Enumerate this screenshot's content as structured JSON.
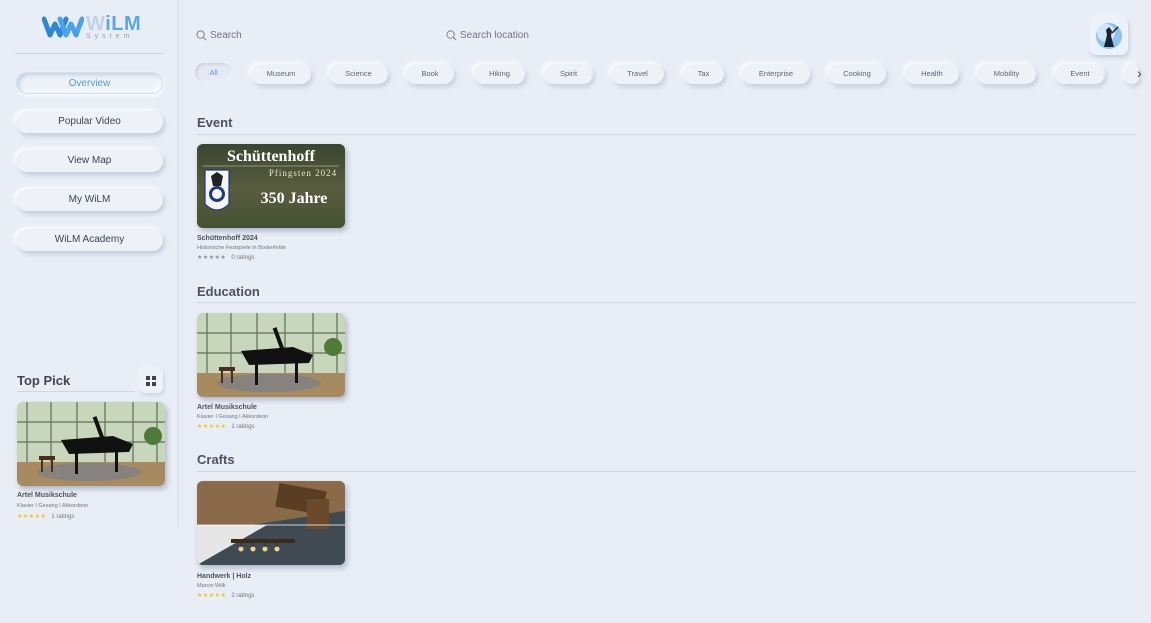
{
  "app": {
    "logo_word_prefix": "W",
    "logo_word_rest": "iLM",
    "logo_sub": "System"
  },
  "sidebar": {
    "nav": [
      {
        "label": "Overview",
        "active": true
      },
      {
        "label": "Popular Video",
        "active": false
      },
      {
        "label": "View Map",
        "active": false
      },
      {
        "label": "My WiLM",
        "active": false
      },
      {
        "label": "WiLM Academy",
        "active": false
      }
    ],
    "top_pick": {
      "title": "Top Pick",
      "card": {
        "title": "Artel Musikschule",
        "subtitle": "Klavier I Gesang I Akkordeon",
        "ratings": "1 ratings",
        "stars": "★★★★★",
        "star_color": "gold"
      }
    }
  },
  "header": {
    "search_placeholder": "Search",
    "location_placeholder": "Search location"
  },
  "categories": {
    "items": [
      "All",
      "Museum",
      "Science",
      "Book",
      "Hiking",
      "Spirit",
      "Travel",
      "Tax",
      "Enterprise",
      "Cooking",
      "Health",
      "Mobility",
      "Event"
    ],
    "active_index": 0
  },
  "sections": [
    {
      "title": "Event",
      "card": {
        "title": "Schüttenhoff 2024",
        "subtitle": "Historische Festspiele in Bodenfelde",
        "ratings": "0 ratings",
        "stars": "★★★★★",
        "star_color": "gray",
        "thumb_title": "Schüttenhoff",
        "thumb_subtitle": "Pfingsten 2024",
        "thumb_highlight": "350 Jahre"
      }
    },
    {
      "title": "Education",
      "card": {
        "title": "Artel Musikschule",
        "subtitle": "Klavier I Gesang I Akkordeon",
        "ratings": "1 ratings",
        "stars": "★★★★★",
        "star_color": "gold"
      }
    },
    {
      "title": "Crafts",
      "card": {
        "title": "Handwerk | Holz",
        "subtitle": "Marcin Wilk",
        "ratings": "2 ratings",
        "stars": "★★★★★",
        "star_color": "gold"
      }
    }
  ],
  "colors": {
    "background": "#e9eef6",
    "accent": "#4f9ae0",
    "star_gold": "#f1c40f",
    "text": "#4a5263"
  }
}
